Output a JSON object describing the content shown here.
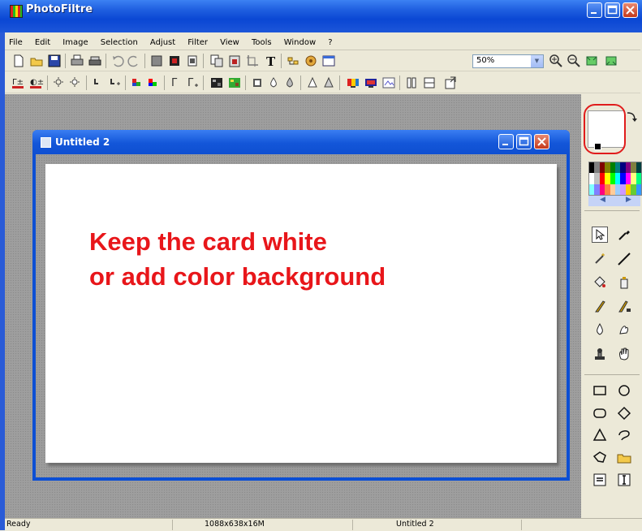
{
  "app": {
    "title": "PhotoFiltre"
  },
  "menu": [
    "File",
    "Edit",
    "Image",
    "Selection",
    "Adjust",
    "Filter",
    "View",
    "Tools",
    "Window",
    "?"
  ],
  "toolbar": {
    "zoom_value": "50%"
  },
  "document": {
    "title": "Untitled 2",
    "canvas_text_line1": "Keep the card white",
    "canvas_text_line2": "or add color background",
    "annotation_color": "#e8161a"
  },
  "palette_colors": [
    "#000000",
    "#808080",
    "#800000",
    "#808000",
    "#008000",
    "#008080",
    "#000080",
    "#800080",
    "#808040",
    "#004040",
    "#ffffff",
    "#c0c0c0",
    "#ff0000",
    "#ffff00",
    "#00ff00",
    "#00ffff",
    "#0000ff",
    "#ff00ff",
    "#ffff80",
    "#00ff80",
    "#80ffff",
    "#8080ff",
    "#ff0080",
    "#ff8040",
    "#ffcc99",
    "#99ccff",
    "#cc99ff",
    "#ffcc00",
    "#66cc33",
    "#3399ff"
  ],
  "palette_nav": {
    "prev": "◀",
    "next": "▶"
  },
  "status": {
    "state": "Ready",
    "image_info": "1088x638x16M",
    "doc_name": "Untitled 2"
  },
  "colors": {
    "titlebar": "#0a47d4",
    "highlight_circle": "#e01c1c",
    "workspace": "#9e9e9e"
  }
}
